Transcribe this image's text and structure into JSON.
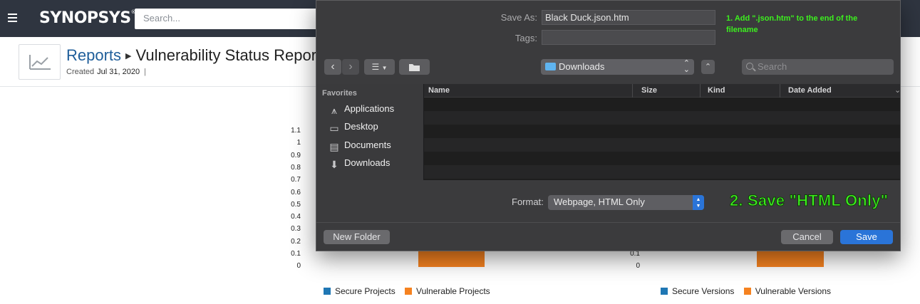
{
  "app": {
    "logo": "SYNOPSYS",
    "search_placeholder": "Search..."
  },
  "page": {
    "breadcrumb_link": "Reports",
    "breadcrumb_current": "Vulnerability Status Report",
    "created_label": "Created",
    "created_date": "Jul 31, 2020",
    "created_separator": "|"
  },
  "charts": {
    "left_ticks": [
      "1.1",
      "1",
      "0.9",
      "0.8",
      "0.7",
      "0.6",
      "0.5",
      "0.4",
      "0.3",
      "0.2",
      "0.1",
      "0"
    ],
    "right_ticks": [
      "0.1",
      "0"
    ],
    "left_legend": [
      "Secure Projects",
      "Vulnerable Projects"
    ],
    "right_legend": [
      "Secure Versions",
      "Vulnerable Versions"
    ],
    "secure_color": "#1f77b4",
    "vulnerable_color": "#f58220"
  },
  "dialog": {
    "save_as_label": "Save As:",
    "save_as_value": "Black Duck.json.htm",
    "tags_label": "Tags:",
    "tags_value": "",
    "annotation_1": "1. Add \".json.htm\" to the end of the filename",
    "location": "Downloads",
    "search_placeholder": "Search",
    "favorites_header": "Favorites",
    "favorites": [
      "Applications",
      "Desktop",
      "Documents",
      "Downloads"
    ],
    "columns": [
      "Name",
      "Size",
      "Kind",
      "Date Added"
    ],
    "format_label": "Format:",
    "format_value": "Webpage, HTML Only",
    "annotation_2": "2. Save \"HTML Only\"",
    "new_folder": "New Folder",
    "cancel": "Cancel",
    "save": "Save",
    "annotation_color": "#3cf01e"
  }
}
